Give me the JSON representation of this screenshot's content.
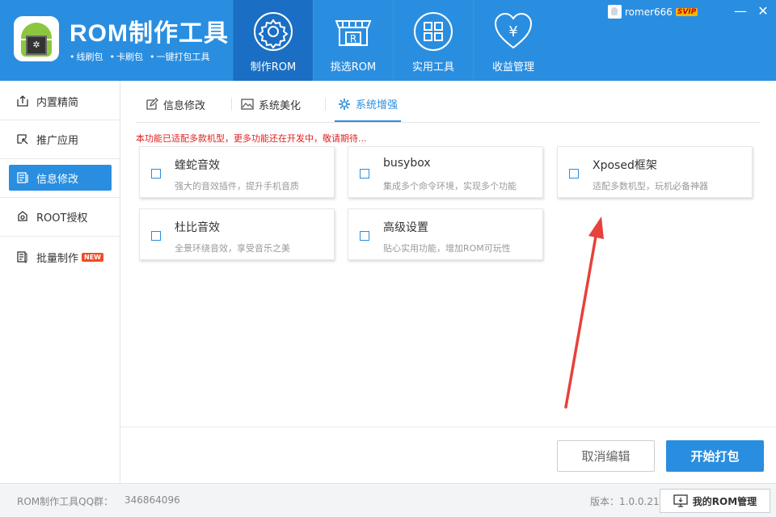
{
  "header": {
    "app_title": "ROM制作工具",
    "tags": [
      "线刷包",
      "卡刷包",
      "一键打包工具"
    ],
    "nav": [
      {
        "label": "制作ROM",
        "icon": "gear-icon",
        "active": true
      },
      {
        "label": "挑选ROM",
        "icon": "store-icon",
        "active": false
      },
      {
        "label": "实用工具",
        "icon": "grid-icon",
        "active": false
      },
      {
        "label": "收益管理",
        "icon": "heart-yen-icon",
        "active": false
      }
    ],
    "user": {
      "name": "romer666",
      "badge": "SVIP"
    }
  },
  "sidebar": {
    "items": [
      {
        "label": "内置精简",
        "icon": "upload-box-icon"
      },
      {
        "label": "推广应用",
        "icon": "promote-icon"
      },
      {
        "label": "信息修改",
        "icon": "document-icon"
      },
      {
        "label": "ROOT授权",
        "icon": "root-icon"
      },
      {
        "label": "批量制作",
        "icon": "batch-edit-icon",
        "badge": "NEW"
      }
    ],
    "active_index": 2
  },
  "tabs": [
    {
      "label": "信息修改",
      "icon": "edit-icon"
    },
    {
      "label": "系统美化",
      "icon": "image-icon"
    },
    {
      "label": "系统增强",
      "icon": "settings-icon",
      "active": true
    }
  ],
  "notice": "本功能已适配多款机型，更多功能还在开发中，敬请期待...",
  "cards": [
    {
      "title": "蝰蛇音效",
      "desc": "强大的音效插件，提升手机音质",
      "checked": false
    },
    {
      "title": "busybox",
      "desc": "集成多个命令环境，实现多个功能",
      "checked": false
    },
    {
      "title": "Xposed框架",
      "desc": "适配多数机型，玩机必备神器",
      "checked": false
    },
    {
      "title": "杜比音效",
      "desc": "全景环绕音效，享受音乐之美",
      "checked": false
    },
    {
      "title": "高级设置",
      "desc": "贴心实用功能，增加ROM可玩性",
      "checked": false
    }
  ],
  "actions": {
    "cancel": "取消编辑",
    "start": "开始打包"
  },
  "footer": {
    "qq_label": "ROM制作工具QQ群：",
    "qq_number": "346864096",
    "version": "版本：1.0.0.21",
    "my_rom": "我的ROM管理"
  },
  "colors": {
    "primary": "#2a8ee0",
    "nav_active": "#1a6fc4",
    "notice": "#e02020",
    "arrow": "#e8403b"
  }
}
